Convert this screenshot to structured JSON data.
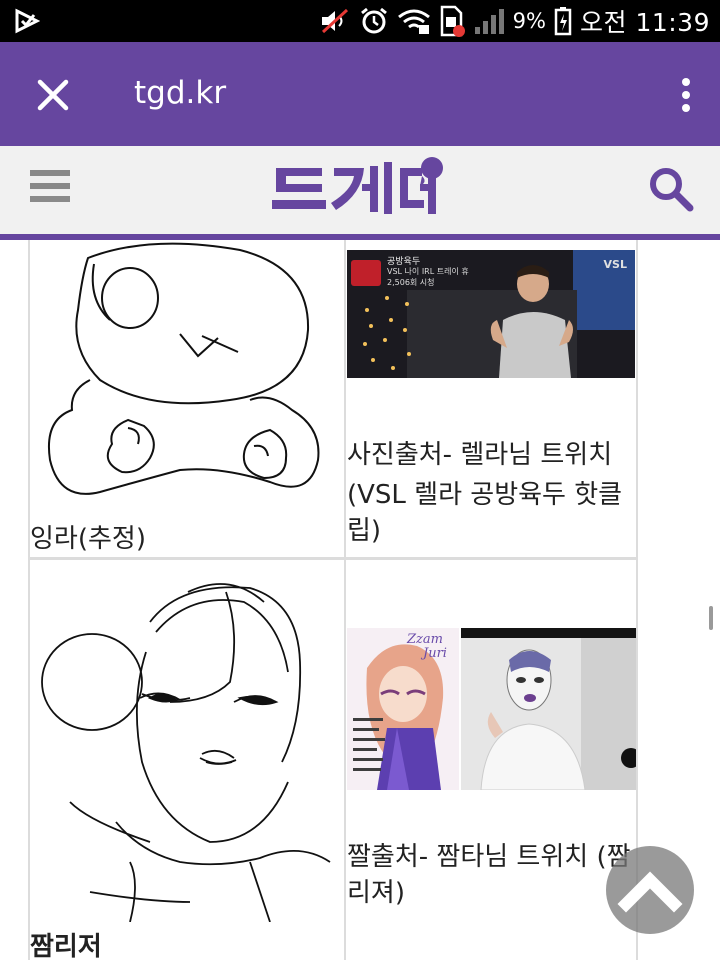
{
  "status_bar": {
    "battery_percent": "9%",
    "time": "오전 11:39",
    "icons": [
      "download-icon",
      "mute-icon",
      "alarm-icon",
      "wifi-icon",
      "sim-icon",
      "signal-icon",
      "battery-icon"
    ]
  },
  "browser": {
    "url": "tgd.kr",
    "close_icon": "close-icon",
    "menu_icon": "more-vert-icon"
  },
  "site": {
    "logo_text": "트게더",
    "brand_color": "#66469f",
    "menu_icon": "hamburger-icon",
    "search_icon": "search-icon"
  },
  "posts": [
    {
      "caption": "잉라(추정)",
      "source_caption_lines": [
        "사진출처- 렐라님 트위치",
        "(VSL 렐라  공방육두 핫클",
        "립)"
      ],
      "photo_overlay": {
        "channel": "공방육두",
        "title": "VSL 나이 IRL 트레이 휴",
        "views": "2,506회 시청",
        "brand": "VSL"
      }
    },
    {
      "caption": "짬리저",
      "source_caption_lines": [
        "짤출처- 짬타님 트위치 (짬",
        "리져)"
      ],
      "photo_overlay": {
        "sign_lines": [
          "Zzam",
          "Juri"
        ]
      }
    }
  ],
  "scroll_top_icon": "chevron-up-icon"
}
